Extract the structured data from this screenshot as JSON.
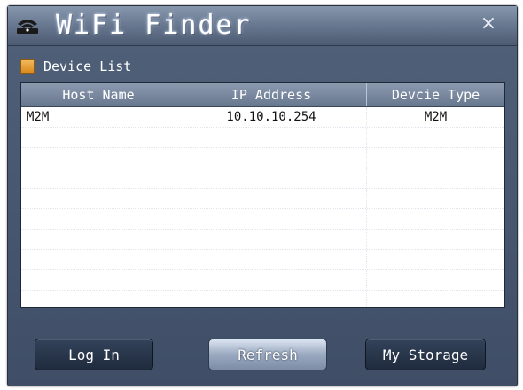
{
  "window": {
    "title": "WiFi Finder",
    "close_symbol": "×",
    "app_icon": "wifi-router-icon"
  },
  "device_list": {
    "label": "Device List",
    "icon": "folder-icon",
    "columns": [
      "Host Name",
      "IP Address",
      "Devcie Type"
    ],
    "rows": [
      {
        "host": "M2M",
        "ip": "10.10.10.254",
        "type": "M2M"
      }
    ],
    "empty_rows": 9
  },
  "buttons": {
    "login": "Log In",
    "refresh": "Refresh",
    "storage": "My Storage"
  },
  "colors": {
    "window_bg": "#4a5a73",
    "titlebar": "#6a7a92",
    "folder_icon": "#e9a53c"
  }
}
